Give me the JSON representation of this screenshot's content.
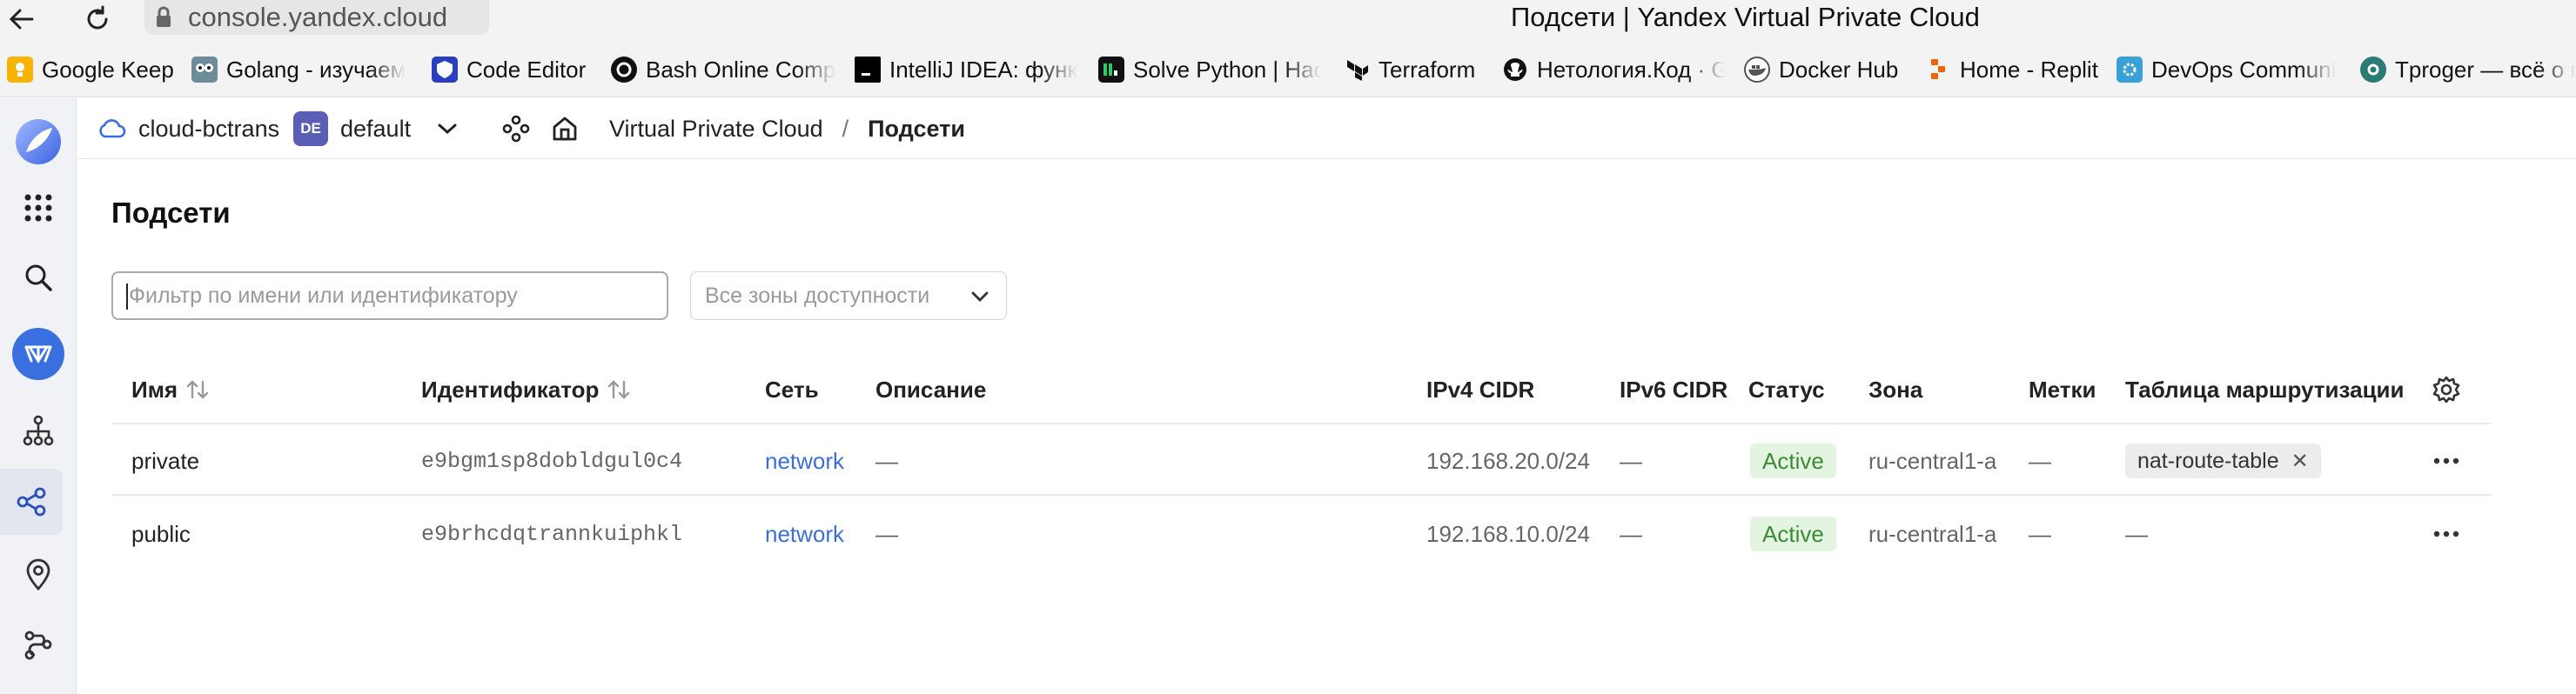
{
  "browser": {
    "url": "console.yandex.cloud",
    "window_title": "Подсети | Yandex Virtual Private Cloud",
    "bookmarks": [
      {
        "label": "Google Keep",
        "icon": "google-keep-icon"
      },
      {
        "label": "Golang - изучаем",
        "icon": "golang-icon"
      },
      {
        "label": "Code Editor",
        "icon": "code-editor-icon"
      },
      {
        "label": "Bash Online Comp",
        "icon": "bash-icon"
      },
      {
        "label": "IntelliJ IDEA: функ",
        "icon": "intellij-icon"
      },
      {
        "label": "Solve Python | Hac",
        "icon": "hackerrank-icon"
      },
      {
        "label": "Terraform",
        "icon": "terraform-icon"
      },
      {
        "label": "Нетология.Код · G",
        "icon": "github-icon"
      },
      {
        "label": "Docker Hub",
        "icon": "docker-icon"
      },
      {
        "label": "Home - Replit",
        "icon": "replit-icon"
      },
      {
        "label": "DevOps Communi",
        "icon": "devops-icon"
      },
      {
        "label": "Tproger — всё о п",
        "icon": "tproger-icon"
      }
    ]
  },
  "appbar": {
    "cloud_name": "cloud-bctrans",
    "folder_badge": "DE",
    "folder_name": "default",
    "breadcrumb_service": "Virtual Private Cloud",
    "breadcrumb_separator": "/",
    "breadcrumb_current": "Подсети"
  },
  "page": {
    "title": "Подсети",
    "filter_placeholder": "Фильтр по имени или идентификатору",
    "zone_select": "Все зоны доступности"
  },
  "table": {
    "headers": {
      "name": "Имя",
      "id": "Идентификатор",
      "network": "Сеть",
      "description": "Описание",
      "ipv4": "IPv4 CIDR",
      "ipv6": "IPv6 CIDR",
      "status": "Статус",
      "zone": "Зона",
      "labels": "Метки",
      "route_table": "Таблица маршрутизации"
    },
    "rows": [
      {
        "name": "private",
        "id": "e9bgm1sp8dobldgul0c4",
        "network": "network",
        "description": "—",
        "ipv4": "192.168.20.0/24",
        "ipv6": "—",
        "status": "Active",
        "zone": "ru-central1-a",
        "labels": "—",
        "route_table": "nat-route-table"
      },
      {
        "name": "public",
        "id": "e9brhcdqtrannkuiphkl",
        "network": "network",
        "description": "—",
        "ipv4": "192.168.10.0/24",
        "ipv6": "—",
        "status": "Active",
        "zone": "ru-central1-a",
        "labels": "—",
        "route_table": "—"
      }
    ]
  },
  "colors": {
    "accent": "#3b6fd6",
    "status_active_bg": "#e3f5e1",
    "status_active_text": "#3a8a36",
    "sidebar_active": "#3a6fe0"
  }
}
